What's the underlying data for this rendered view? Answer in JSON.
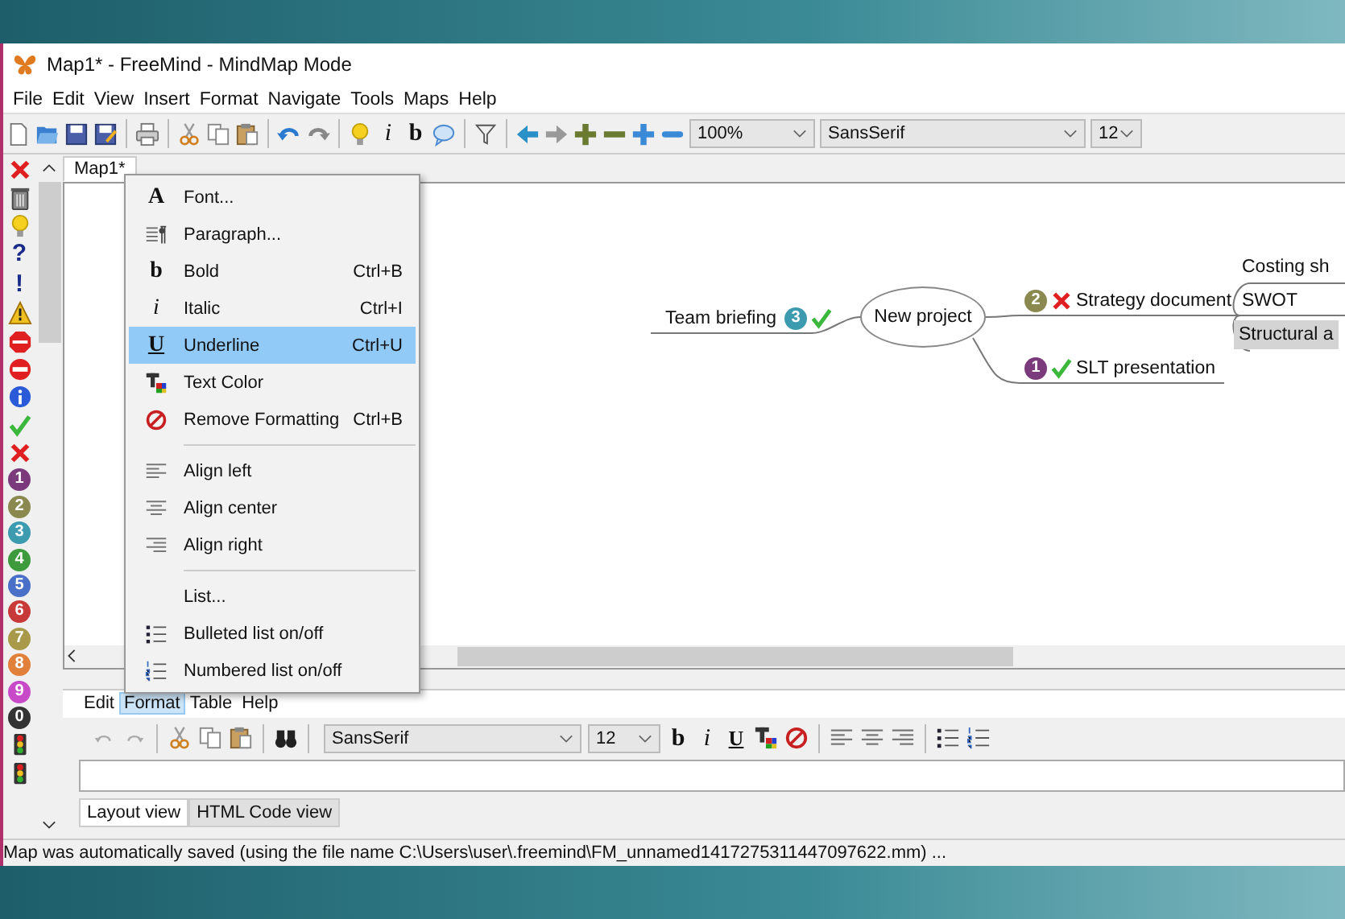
{
  "window": {
    "title": "Map1* - FreeMind - MindMap Mode"
  },
  "menubar": [
    "File",
    "Edit",
    "View",
    "Insert",
    "Format",
    "Navigate",
    "Tools",
    "Maps",
    "Help"
  ],
  "toolbar": {
    "italic_glyph": "i",
    "bold_glyph": "b",
    "zoom": "100%",
    "font": "SansSerif",
    "font_size": "12"
  },
  "icon_palette": [
    {
      "kind": "cross"
    },
    {
      "kind": "trash"
    },
    {
      "kind": "bulb"
    },
    {
      "kind": "glyph",
      "label": "?"
    },
    {
      "kind": "glyph",
      "label": "!"
    },
    {
      "kind": "warning"
    },
    {
      "kind": "stop"
    },
    {
      "kind": "no-entry"
    },
    {
      "kind": "info"
    },
    {
      "kind": "check"
    },
    {
      "kind": "cross"
    },
    {
      "kind": "number",
      "label": "1",
      "color": "#7b3a7b"
    },
    {
      "kind": "number",
      "label": "2",
      "color": "#8a8a50"
    },
    {
      "kind": "number",
      "label": "3",
      "color": "#3d9bb0"
    },
    {
      "kind": "number",
      "label": "4",
      "color": "#3d9b3d"
    },
    {
      "kind": "number",
      "label": "5",
      "color": "#4a6fc8"
    },
    {
      "kind": "number",
      "label": "6",
      "color": "#c83a3a"
    },
    {
      "kind": "number",
      "label": "7",
      "color": "#a89a48"
    },
    {
      "kind": "number",
      "label": "8",
      "color": "#e0803a"
    },
    {
      "kind": "number",
      "label": "9",
      "color": "#c84ac8"
    },
    {
      "kind": "number",
      "label": "0",
      "color": "#333333"
    },
    {
      "kind": "traffic-light"
    },
    {
      "kind": "traffic-light"
    }
  ],
  "map_tabs": [
    {
      "label": "Map1*",
      "selected": true
    }
  ],
  "mind_map": {
    "root": {
      "text": "New project",
      "children": [
        {
          "text": "Strategy document",
          "selected": false,
          "badges": [
            {
              "kind": "number",
              "label": "2",
              "color": "#8a8a50"
            },
            {
              "kind": "cross"
            }
          ],
          "children": [
            {
              "text": "Costing sh",
              "selected": false
            },
            {
              "text": "SWOT",
              "selected": false
            },
            {
              "text": "Structural a",
              "selected": true
            }
          ]
        },
        {
          "text": "SLT presentation",
          "selected": false,
          "badges": [
            {
              "kind": "number",
              "label": "1",
              "color": "#7b3a7b"
            },
            {
              "kind": "check"
            }
          ]
        },
        {
          "text": "Team briefing",
          "selected": false,
          "badges": [
            {
              "kind": "number",
              "label": "3",
              "color": "#3d9bb0"
            },
            {
              "kind": "check"
            }
          ]
        }
      ]
    }
  },
  "format_menu": {
    "groups": [
      [
        {
          "kind": "glyph-serif",
          "glyph": "A",
          "label": "Font...",
          "selected": false
        },
        {
          "kind": "paragraph",
          "label": "Paragraph...",
          "selected": false
        },
        {
          "kind": "glyph-serif",
          "glyph": "b",
          "label": "Bold",
          "shortcut": "Ctrl+B",
          "selected": false
        },
        {
          "kind": "glyph-italic",
          "glyph": "i",
          "label": "Italic",
          "shortcut": "Ctrl+I",
          "selected": false
        },
        {
          "kind": "glyph-underline",
          "glyph": "U",
          "label": "Underline",
          "shortcut": "Ctrl+U",
          "selected": true
        },
        {
          "kind": "text-color",
          "label": "Text Color",
          "selected": false
        },
        {
          "kind": "remove-format",
          "label": "Remove Formatting",
          "shortcut": "Ctrl+B",
          "selected": false
        }
      ],
      [
        {
          "kind": "align-left",
          "label": "Align left",
          "selected": false
        },
        {
          "kind": "align-center",
          "label": "Align center",
          "selected": false
        },
        {
          "kind": "align-right",
          "label": "Align right",
          "selected": false
        }
      ],
      [
        {
          "kind": "none",
          "label": "List...",
          "selected": false
        },
        {
          "kind": "bullet-list",
          "label": "Bulleted list on/off",
          "selected": false
        },
        {
          "kind": "number-list",
          "label": "Numbered list on/off",
          "selected": false
        }
      ]
    ]
  },
  "editor": {
    "menubar": [
      {
        "label": "Edit",
        "selected": false
      },
      {
        "label": "Format",
        "selected": true
      },
      {
        "label": "Table",
        "selected": false
      },
      {
        "label": "Help",
        "selected": false
      }
    ],
    "toolbar": {
      "font": "SansSerif",
      "font_size": "12",
      "bold_glyph": "b",
      "italic_glyph": "i",
      "underline_glyph": "U"
    },
    "view_tabs": [
      {
        "label": "Layout view",
        "selected": true
      },
      {
        "label": "HTML Code view",
        "selected": false
      }
    ]
  },
  "status_bar": "Map was automatically saved (using the file name C:\\Users\\user\\.freemind\\FM_unnamed1417275311447097622.mm) ..."
}
